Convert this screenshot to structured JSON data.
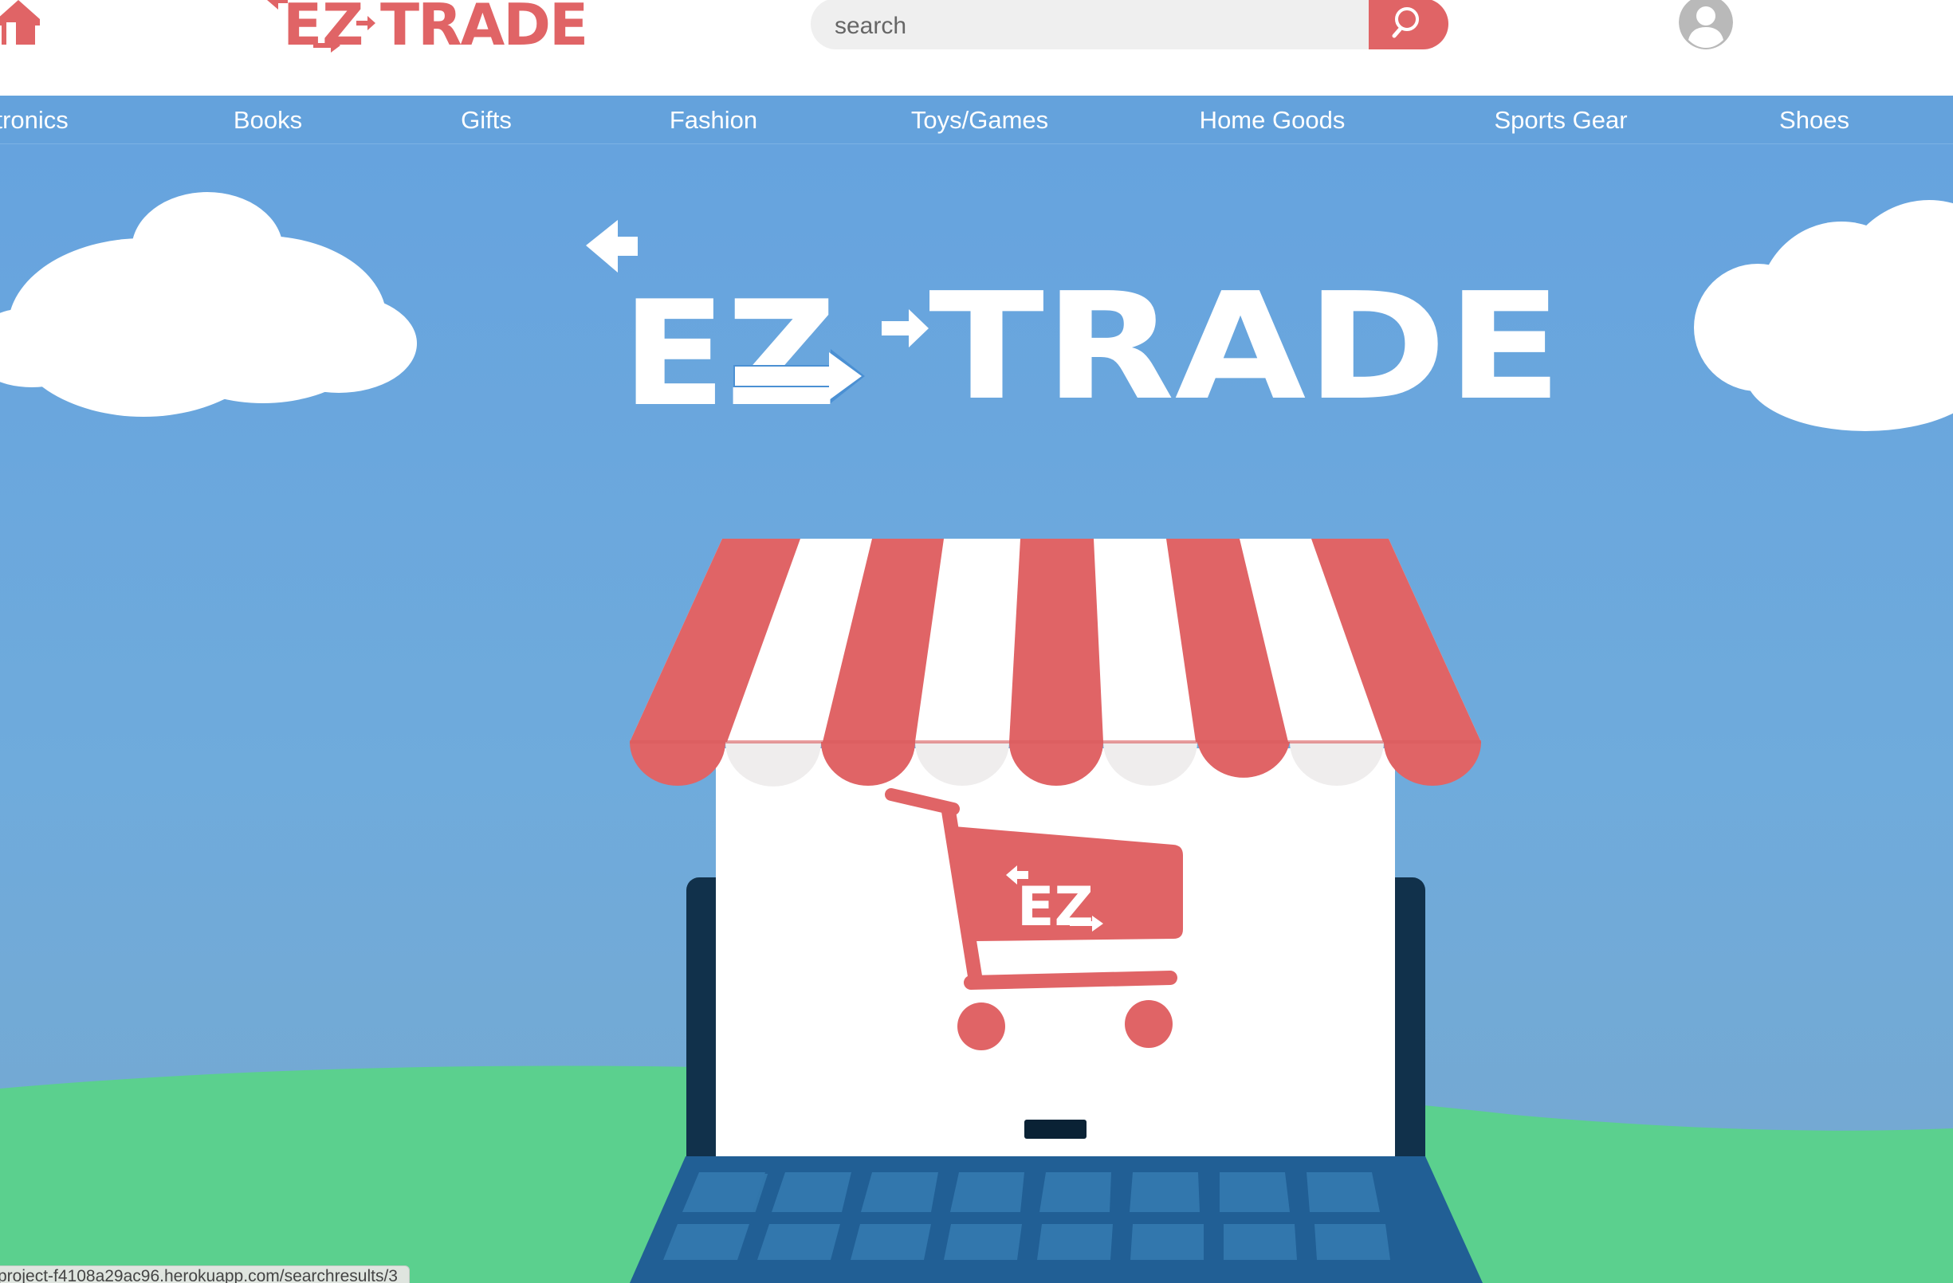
{
  "header": {
    "logo": {
      "text": "EZ-TRADE",
      "color": "#e06466"
    },
    "search": {
      "placeholder": "search",
      "value": ""
    },
    "icons": {
      "home": "home-icon",
      "search": "search-icon",
      "avatar": "user-avatar-icon"
    }
  },
  "nav": {
    "items": [
      {
        "label": "Electronics"
      },
      {
        "label": "Books"
      },
      {
        "label": "Gifts"
      },
      {
        "label": "Fashion"
      },
      {
        "label": "Toys/Games"
      },
      {
        "label": "Home Goods"
      },
      {
        "label": "Sports Gear"
      },
      {
        "label": "Shoes"
      }
    ]
  },
  "hero": {
    "title": "EZ-TRADE",
    "cart_badge": "EZ"
  },
  "status_bar": {
    "url": "project-f4108a29ac96.herokuapp.com/searchresults/3"
  },
  "colors": {
    "brand_red": "#e06466",
    "nav_blue": "#64a2dc",
    "sky_top": "#66a3de",
    "sky_bottom": "#73a9d6",
    "grass": "#5bd08e",
    "laptop_frame": "#11314b",
    "keyboard": "#215f95"
  }
}
